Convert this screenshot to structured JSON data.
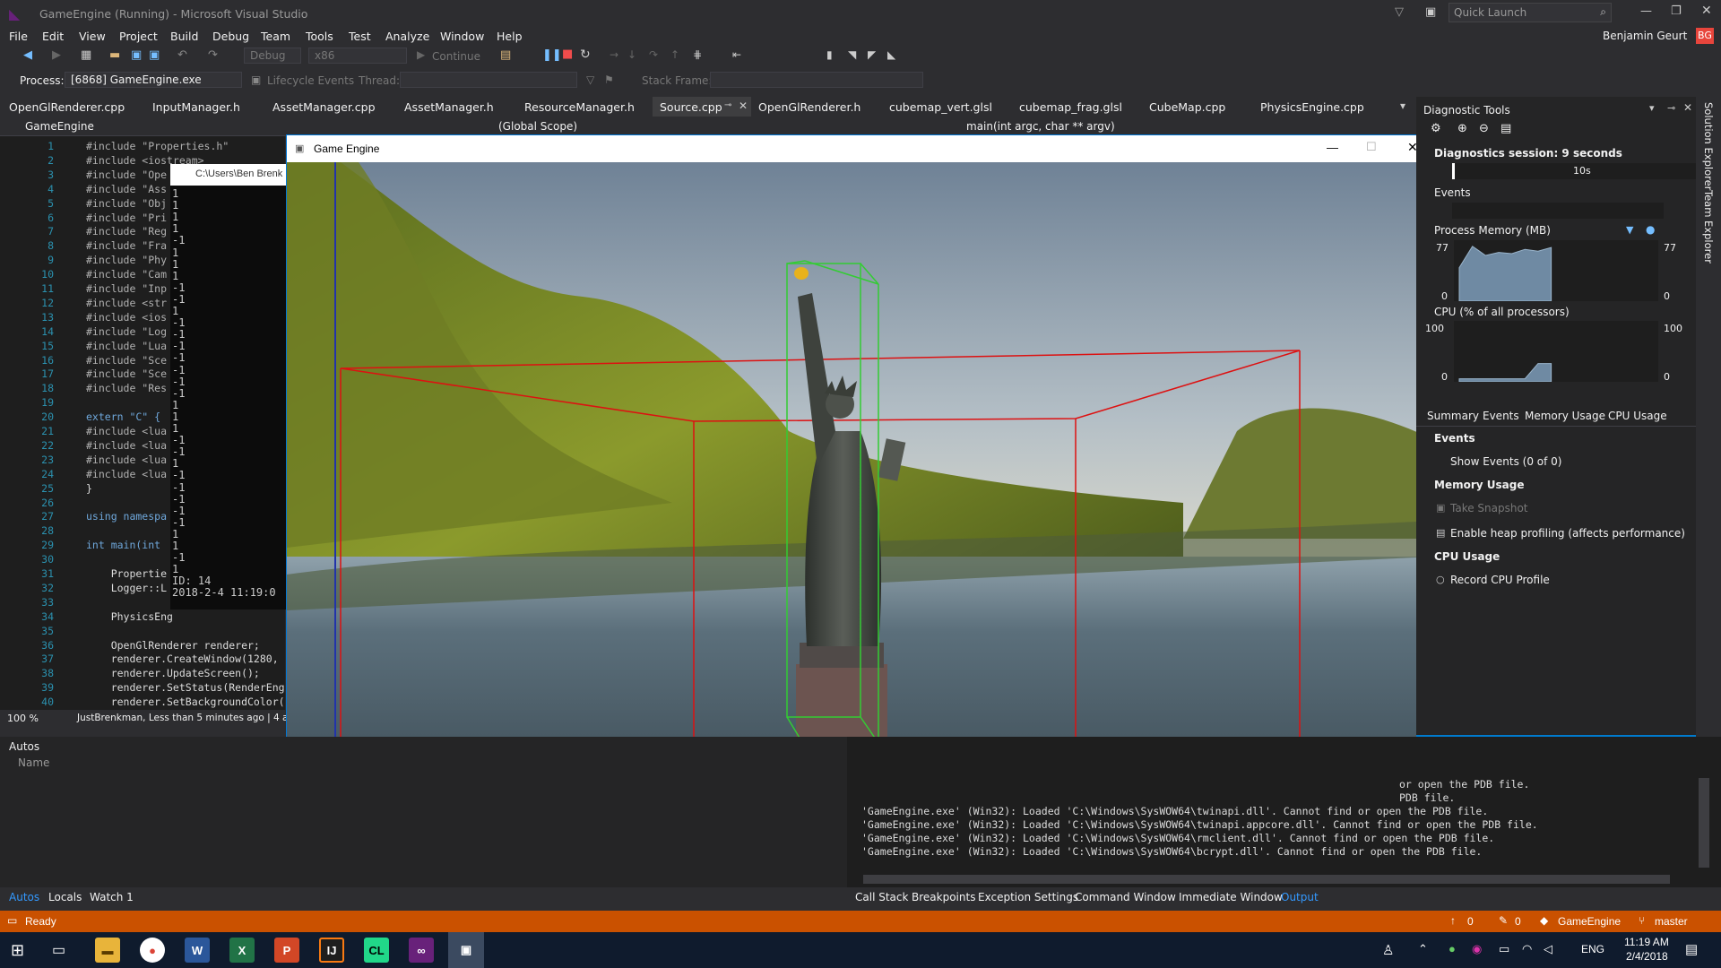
{
  "window": {
    "title": "GameEngine (Running) - Microsoft Visual Studio",
    "quick_launch": "Quick Launch",
    "user": "Benjamin Geurt",
    "user_initials": "BG"
  },
  "menu": [
    "File",
    "Edit",
    "View",
    "Project",
    "Build",
    "Debug",
    "Team",
    "Tools",
    "Test",
    "Analyze",
    "Window",
    "Help"
  ],
  "toolbar": {
    "config": "Debug",
    "platform": "x86",
    "continue": "Continue"
  },
  "toolbar2": {
    "process_label": "Process:",
    "process_value": "[6868] GameEngine.exe",
    "lifecycle": "Lifecycle Events",
    "thread_label": "Thread:",
    "stackframe_label": "Stack Frame:"
  },
  "tabs": [
    "OpenGlRenderer.cpp",
    "InputManager.h",
    "AssetManager.cpp",
    "AssetManager.h",
    "ResourceManager.h",
    "Source.cpp",
    "OpenGlRenderer.h",
    "cubemap_vert.glsl",
    "cubemap_frag.glsl",
    "CubeMap.cpp",
    "PhysicsEngine.cpp"
  ],
  "nav": {
    "project": "GameEngine",
    "scope": "(Global Scope)",
    "func": "main(int argc, char ** argv)"
  },
  "code_lines": [
    {
      "n": "1",
      "t": "#include \"Properties.h\""
    },
    {
      "n": "2",
      "t": "#include <iostream>"
    },
    {
      "n": "3",
      "t": "#include \"Ope"
    },
    {
      "n": "4",
      "t": "#include \"Ass"
    },
    {
      "n": "5",
      "t": "#include \"Obj"
    },
    {
      "n": "6",
      "t": "#include \"Pri"
    },
    {
      "n": "7",
      "t": "#include \"Reg"
    },
    {
      "n": "8",
      "t": "#include \"Fra"
    },
    {
      "n": "9",
      "t": "#include \"Phy"
    },
    {
      "n": "10",
      "t": "#include \"Cam"
    },
    {
      "n": "11",
      "t": "#include \"Inp"
    },
    {
      "n": "12",
      "t": "#include <str"
    },
    {
      "n": "13",
      "t": "#include <ios"
    },
    {
      "n": "14",
      "t": "#include \"Log"
    },
    {
      "n": "15",
      "t": "#include \"Lua"
    },
    {
      "n": "16",
      "t": "#include \"Sce"
    },
    {
      "n": "17",
      "t": "#include \"Sce"
    },
    {
      "n": "18",
      "t": "#include \"Res"
    },
    {
      "n": "19",
      "t": ""
    },
    {
      "n": "20",
      "t": "extern \"C\" {"
    },
    {
      "n": "21",
      "t": "#include <lua"
    },
    {
      "n": "22",
      "t": "#include <lua"
    },
    {
      "n": "23",
      "t": "#include <lua"
    },
    {
      "n": "24",
      "t": "#include <lua"
    },
    {
      "n": "25",
      "t": "}"
    },
    {
      "n": "26",
      "t": ""
    },
    {
      "n": "27",
      "t": "using namespa"
    },
    {
      "n": "28",
      "t": ""
    },
    {
      "n": "29",
      "t": "int main(int"
    },
    {
      "n": "30",
      "t": ""
    },
    {
      "n": "31",
      "t": "    Propertie"
    },
    {
      "n": "32",
      "t": "    Logger::L"
    },
    {
      "n": "33",
      "t": ""
    },
    {
      "n": "34",
      "t": "    PhysicsEng"
    },
    {
      "n": "35",
      "t": ""
    },
    {
      "n": "36",
      "t": "    OpenGlRenderer renderer;"
    },
    {
      "n": "37",
      "t": "    renderer.CreateWindow(1280,"
    },
    {
      "n": "38",
      "t": "    renderer.UpdateScreen();"
    },
    {
      "n": "39",
      "t": "    renderer.SetStatus(RenderEng"
    },
    {
      "n": "40",
      "t": "    renderer.SetBackgroundColor("
    }
  ],
  "editor_footer": {
    "zoom": "100 %",
    "blame": "JustBrenkman, Less than 5 minutes ago | 4 autho"
  },
  "console": {
    "title": "C:\\Users\\Ben Brenk",
    "lines": [
      "1",
      "1",
      "1",
      "1",
      "-1",
      "1",
      "1",
      "1",
      "-1",
      "-1",
      "1",
      "-1",
      "-1",
      "-1",
      "-1",
      "-1",
      "-1",
      "-1",
      "1",
      "1",
      "1",
      "-1",
      "-1",
      "1",
      "-1",
      "-1",
      "-1",
      "-1",
      "-1",
      "1",
      "1",
      "-1",
      "1",
      "ID: 14",
      "2018-2-4 11:19:0"
    ]
  },
  "game": {
    "title": "Game Engine"
  },
  "diag": {
    "title": "Diagnostic Tools",
    "session": "Diagnostics session: 9 seconds",
    "timeline_label": "10s",
    "events": "Events",
    "memory": "Process Memory (MB)",
    "mem_max": "77",
    "mem_min": "0",
    "cpu": "CPU (% of all processors)",
    "cpu_max": "100",
    "cpu_min": "0",
    "subtabs": [
      "Summary",
      "Events",
      "Memory Usage",
      "CPU Usage"
    ],
    "sec_events": "Events",
    "show_events": "Show Events (0 of 0)",
    "sec_memory": "Memory Usage",
    "take_snapshot": "Take Snapshot",
    "heap": "Enable heap profiling (affects performance)",
    "sec_cpu": "CPU Usage",
    "record_cpu": "Record CPU Profile",
    "memory_fraction": [
      0.55,
      0.9,
      0.75,
      0.8,
      0.78,
      0.85,
      0.82,
      0.88
    ],
    "cpu_fraction": [
      0.05,
      0.05,
      0.05,
      0.05,
      0.05,
      0.05,
      0.3,
      0.3
    ]
  },
  "side_tabs": [
    "Solution Explorer",
    "Team Explorer"
  ],
  "autos": {
    "title": "Autos",
    "col_name": "Name"
  },
  "output": {
    "lines": [
      "or open the PDB file.",
      "PDB file.",
      "'GameEngine.exe' (Win32): Loaded 'C:\\Windows\\SysWOW64\\twinapi.dll'. Cannot find or open the PDB file.",
      "'GameEngine.exe' (Win32): Loaded 'C:\\Windows\\SysWOW64\\twinapi.appcore.dll'. Cannot find or open the PDB file.",
      "'GameEngine.exe' (Win32): Loaded 'C:\\Windows\\SysWOW64\\rmclient.dll'. Cannot find or open the PDB file.",
      "'GameEngine.exe' (Win32): Loaded 'C:\\Windows\\SysWOW64\\bcrypt.dll'. Cannot find or open the PDB file."
    ]
  },
  "bottom_left_tabs": [
    "Autos",
    "Locals",
    "Watch 1"
  ],
  "bottom_right_tabs": [
    "Call Stack",
    "Breakpoints",
    "Exception Settings",
    "Command Window",
    "Immediate Window",
    "Output"
  ],
  "status": {
    "ready": "Ready",
    "up_count": "0",
    "pencil_count": "0",
    "repo": "GameEngine",
    "branch": "master"
  },
  "taskbar": {
    "time": "11:19 AM",
    "date": "2/4/2018",
    "lang": "ENG"
  },
  "colors": {
    "accent": "#007acc",
    "status": "#ca5100",
    "taskbar": "#0f1b2d"
  }
}
